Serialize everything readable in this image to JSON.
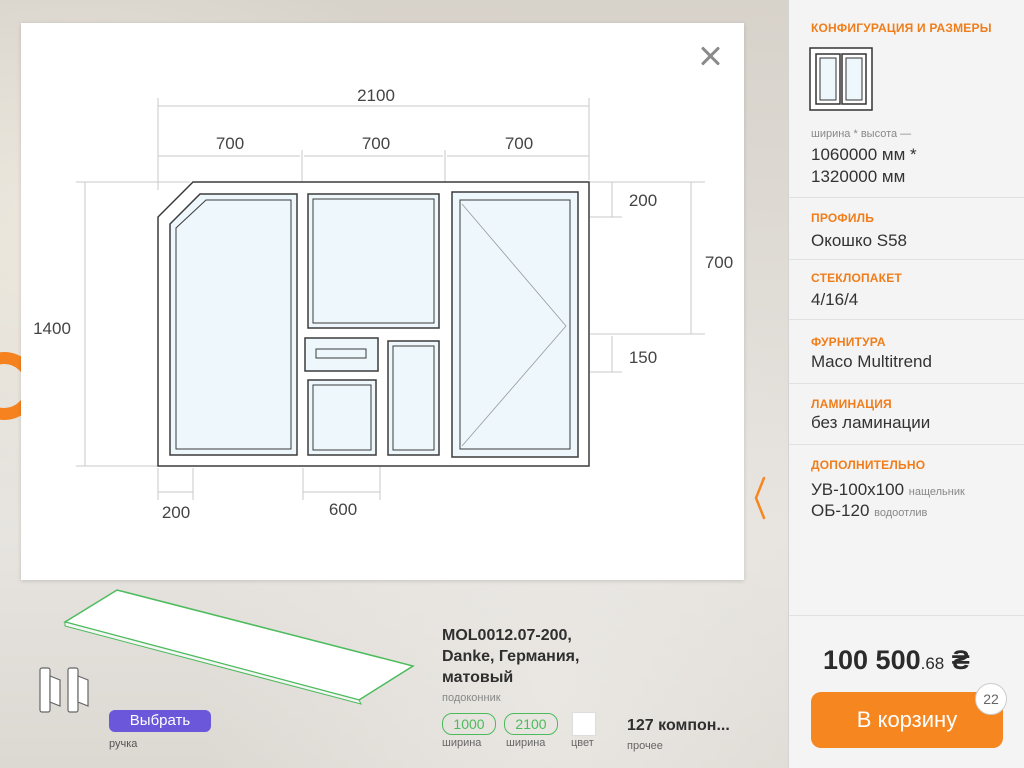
{
  "drawing": {
    "dims": {
      "total_width": "2100",
      "seg1": "700",
      "seg2": "700",
      "seg3": "700",
      "total_height": "1400",
      "top_right": "200",
      "right_mid": "700",
      "right_bottom": "150",
      "bottom_left": "200",
      "bottom_mid": "600"
    }
  },
  "bottom": {
    "select_label": "Выбрать",
    "handle_caption": "ручка",
    "sill_name": "MOL0012.07-200, Danke, Германия, матовый",
    "sill_category": "подоконник",
    "width_value": "1000",
    "width_label": "ширина",
    "length_value": "2100",
    "length_label": "ширина",
    "color_label": "цвет",
    "components": "127 компон...",
    "components_label": "прочее"
  },
  "panel": {
    "config_title": "КОНФИГУРАЦИЯ И РАЗМЕРЫ",
    "size_caption": "ширина * высота —",
    "size_line1": "1060000 мм *",
    "size_line2": "1320000 мм",
    "profile_title": "ПРОФИЛЬ",
    "profile_value": "Окошко S58",
    "glass_title": "СТЕКЛОПАКЕТ",
    "glass_value": "4/16/4",
    "hardware_title": "ФУРНИТУРА",
    "hardware_value": "Maco Multitrend",
    "lamination_title": "ЛАМИНАЦИЯ",
    "lamination_value": "без ламинации",
    "extra_title": "ДОПОЛНИТЕЛЬНО",
    "extra1_value": "УВ-100х100",
    "extra1_note": "нащельник",
    "extra2_value": "ОБ-120",
    "extra2_note": "водоотлив",
    "price_main": "100 500",
    "price_cents": ".68",
    "currency": "₴",
    "cart_label": "В корзину",
    "cart_count": "22"
  },
  "colors": {
    "accent": "#f68620",
    "select": "#6b57d9",
    "green": "#4cbb5c"
  }
}
